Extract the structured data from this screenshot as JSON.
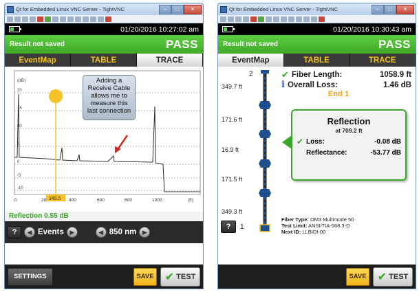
{
  "left_window": {
    "title": "Qt for Embedded Linux VNC Server - TightVNC",
    "datetime": "01/20/2016 10:27:02 am",
    "result_text": "Result not saved",
    "result_status": "PASS",
    "tabs": [
      {
        "label": "EventMap",
        "active": false
      },
      {
        "label": "TABLE",
        "active": false
      },
      {
        "label": "TRACE",
        "active": true
      }
    ],
    "callout_text": "Adding a Receive Cable allows me to measure this last connection",
    "trace": {
      "y_unit": "(dB)",
      "y_ticks": [
        "20",
        "15",
        "10",
        "5",
        "0",
        "-5",
        "-10"
      ],
      "x_ticks": [
        "0",
        "200",
        "400",
        "600",
        "800",
        "1000"
      ],
      "x_unit": "(ft)",
      "cursor_value": "349.5"
    },
    "info_line": "Reflection 0.55 dB",
    "controls": {
      "help": "?",
      "events_label": "Events",
      "wavelength_label": "850 nm"
    },
    "buttons": {
      "settings": "SETTINGS",
      "save": "SAVE",
      "test": "TEST"
    }
  },
  "right_window": {
    "title": "Qt for Embedded Linux VNC Server - TightVNC",
    "datetime": "01/20/2016 10:30:43 am",
    "result_text": "Result not saved",
    "result_status": "PASS",
    "tabs": [
      {
        "label": "EventMap",
        "active": true
      },
      {
        "label": "TABLE",
        "active": false
      },
      {
        "label": "TRACE",
        "active": false
      }
    ],
    "summary": {
      "fiber_length_label": "Fiber Length:",
      "fiber_length_value": "1058.9 ft",
      "overall_loss_label": "Overall Loss:",
      "overall_loss_value": "1.46 dB",
      "end_label": "End 1"
    },
    "ladder": {
      "top_index": "2",
      "bottom_index": "1",
      "distances": [
        "349.7 ft",
        "171.6 ft",
        "16.9 ft",
        "171.5 ft",
        "349.3 ft"
      ]
    },
    "popup": {
      "title": "Reflection",
      "subtitle": "at 709.2 ft",
      "loss_label": "Loss:",
      "loss_value": "-0.08 dB",
      "reflectance_label": "Reflectance:",
      "reflectance_value": "-53.77 dB"
    },
    "fiber_info": {
      "type_label": "Fiber Type:",
      "type_value": "OM3 Multimode 50",
      "limit_label": "Test Limit:",
      "limit_value": "ANSI/TIA-568.3-D",
      "next_label": "Next ID:",
      "next_value": "LLBIDI-00"
    },
    "help": "?",
    "buttons": {
      "save": "SAVE",
      "test": "TEST"
    }
  },
  "colors": {
    "pass_green": "#4fbf34",
    "tab_yellow": "#f7c521",
    "save_yellow": "#f4bd25",
    "trace_cursor": "#f5c22a",
    "arrow_red": "#d0281c",
    "fiber_blue": "#1f4f8f"
  },
  "icons": [
    "app-icon",
    "battery-icon",
    "help-icon",
    "left-arrow-icon",
    "right-arrow-icon",
    "check-icon",
    "info-icon",
    "minimize-icon",
    "maximize-icon",
    "close-icon"
  ]
}
